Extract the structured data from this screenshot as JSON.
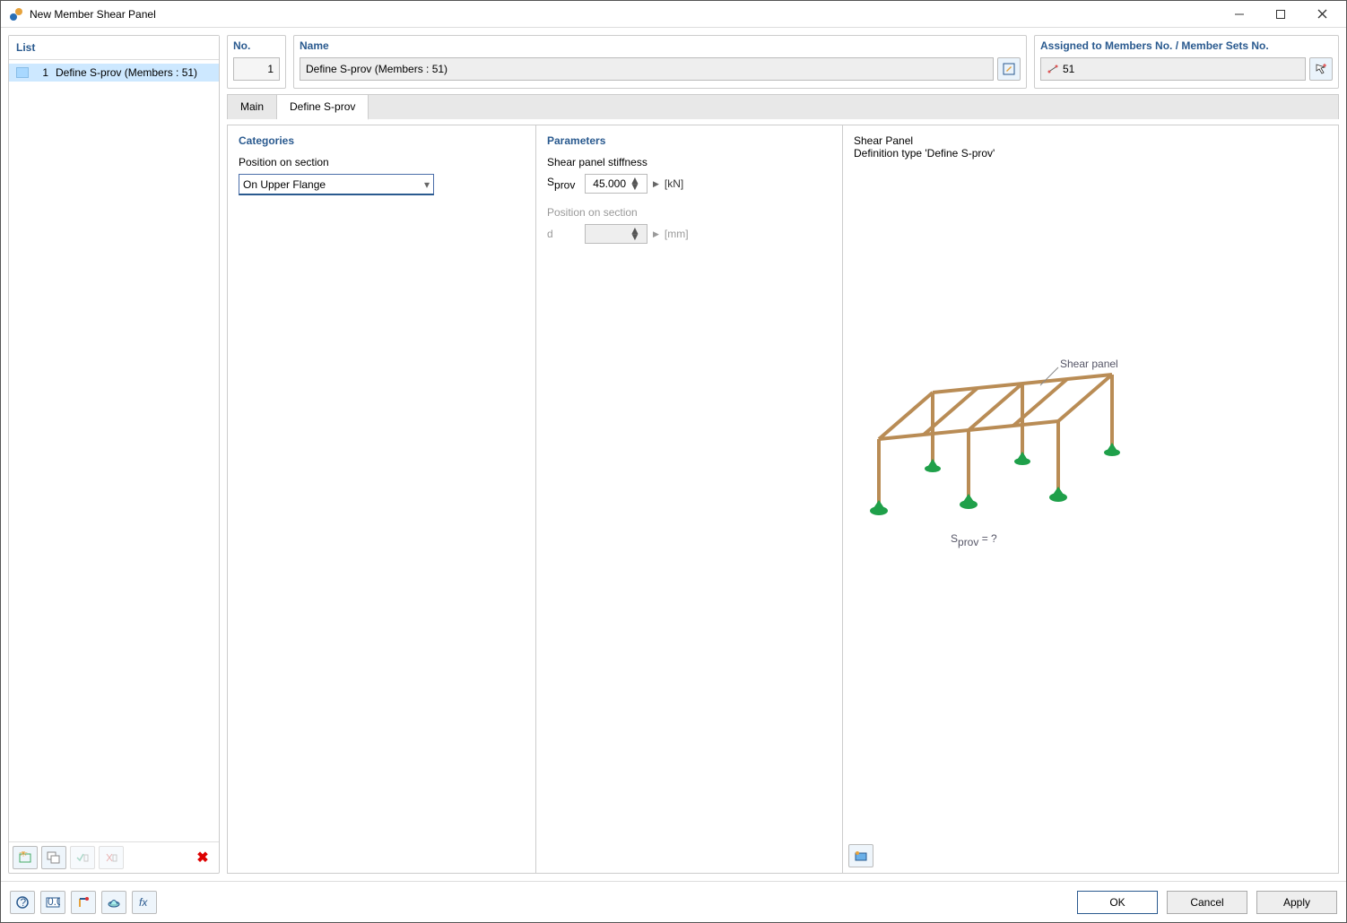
{
  "window": {
    "title": "New Member Shear Panel"
  },
  "left": {
    "header": "List",
    "items": [
      {
        "index": "1",
        "label": "Define S-prov (Members : 51)"
      }
    ]
  },
  "top": {
    "no_label": "No.",
    "no_value": "1",
    "name_label": "Name",
    "name_value": "Define S-prov (Members : 51)",
    "assigned_label": "Assigned to Members No. / Member Sets No.",
    "assigned_value": "51"
  },
  "tabs": [
    {
      "label": "Main",
      "active": false
    },
    {
      "label": "Define S-prov",
      "active": true
    }
  ],
  "categories": {
    "title": "Categories",
    "position_label": "Position on section",
    "position_value": "On Upper Flange"
  },
  "parameters": {
    "title": "Parameters",
    "stiffness_label": "Shear panel stiffness",
    "sprov_symbol_main": "S",
    "sprov_symbol_sub": "prov",
    "sprov_value": "45.000",
    "sprov_unit": "[kN]",
    "pos_label": "Position on section",
    "d_symbol": "d",
    "d_value": "",
    "d_unit": "[mm]"
  },
  "preview": {
    "line1": "Shear Panel",
    "line2": "Definition type 'Define S-prov'",
    "ill_label_panel": "Shear panel",
    "ill_label_formula_main": "S",
    "ill_label_formula_sub": "prov",
    "ill_label_formula_eq": " = ?"
  },
  "footer": {
    "ok": "OK",
    "cancel": "Cancel",
    "apply": "Apply"
  }
}
